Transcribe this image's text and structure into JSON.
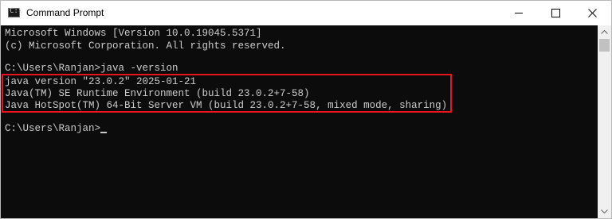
{
  "window": {
    "title": "Command Prompt",
    "icon": "cmd-app-icon"
  },
  "window_controls": {
    "minimize_icon": "minimize-icon",
    "maximize_icon": "maximize-icon",
    "close_icon": "close-icon"
  },
  "console": {
    "lines": [
      "Microsoft Windows [Version 10.0.19045.5371]",
      "(c) Microsoft Corporation. All rights reserved.",
      "",
      "C:\\Users\\Ranjan>java -version",
      "java version \"23.0.2\" 2025-01-21",
      "Java(TM) SE Runtime Environment (build 23.0.2+7-58)",
      "Java HotSpot(TM) 64-Bit Server VM (build 23.0.2+7-58, mixed mode, sharing)",
      "",
      "C:\\Users\\Ranjan>"
    ],
    "highlighted_lines": [
      4,
      6
    ]
  },
  "colors": {
    "console_background": "#0c0c0c",
    "console_text": "#cccccc",
    "highlight_border": "#e8141b"
  },
  "scrollbar": {
    "up_icon": "scroll-up-arrow-icon",
    "down_icon": "scroll-down-arrow-icon"
  }
}
